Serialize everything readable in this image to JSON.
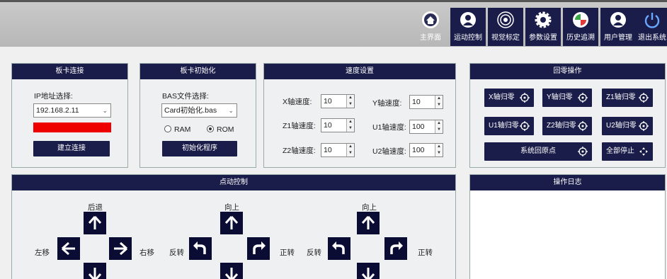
{
  "nav": [
    {
      "label": "主界面",
      "icon": "home-icon",
      "active": false
    },
    {
      "label": "运动控制",
      "icon": "motion-icon",
      "active": true
    },
    {
      "label": "视觉标定",
      "icon": "vision-icon",
      "active": false
    },
    {
      "label": "参数设置",
      "icon": "gear-icon",
      "active": false
    },
    {
      "label": "历史追溯",
      "icon": "history-icon",
      "active": false
    },
    {
      "label": "用户管理",
      "icon": "user-icon",
      "active": false
    },
    {
      "label": "退出系统",
      "icon": "power-icon",
      "active": false
    }
  ],
  "card_connect": {
    "title": "板卡连接",
    "ip_label": "IP地址选择:",
    "ip_value": "192.168.2.11",
    "status_color": "#ee0000",
    "connect_button": "建立连接"
  },
  "card_init": {
    "title": "板卡初始化",
    "bas_label": "BAS文件选择:",
    "bas_value": "Card初始化.bas",
    "ram_label": "RAM",
    "rom_label": "ROM",
    "selected": "ROM",
    "init_button": "初始化程序"
  },
  "speed": {
    "title": "速度设置",
    "fields": [
      {
        "label": "X轴速度:",
        "value": "10"
      },
      {
        "label": "Y轴速度:",
        "value": "10"
      },
      {
        "label": "Z1轴速度:",
        "value": "10"
      },
      {
        "label": "U1轴速度:",
        "value": "100"
      },
      {
        "label": "Z2轴速度:",
        "value": "10"
      },
      {
        "label": "U2轴速度:",
        "value": "100"
      }
    ]
  },
  "homing": {
    "title": "回零操作",
    "buttons": [
      "X轴归零",
      "Y轴归零",
      "Z1轴归零",
      "U1轴归零",
      "Z2轴归零",
      "U2轴归零"
    ],
    "system_home": "系统回原点",
    "stop_all": "全部停止"
  },
  "jog": {
    "title": "点动控制",
    "g1_up": "后退",
    "g1_left": "左移",
    "g1_right": "右移",
    "g2_up": "向上",
    "g2_left": "反转",
    "g2_right": "正转",
    "g3_up": "向上",
    "g3_left": "反转",
    "g3_right": "正转"
  },
  "log": {
    "title": "操作日志"
  }
}
